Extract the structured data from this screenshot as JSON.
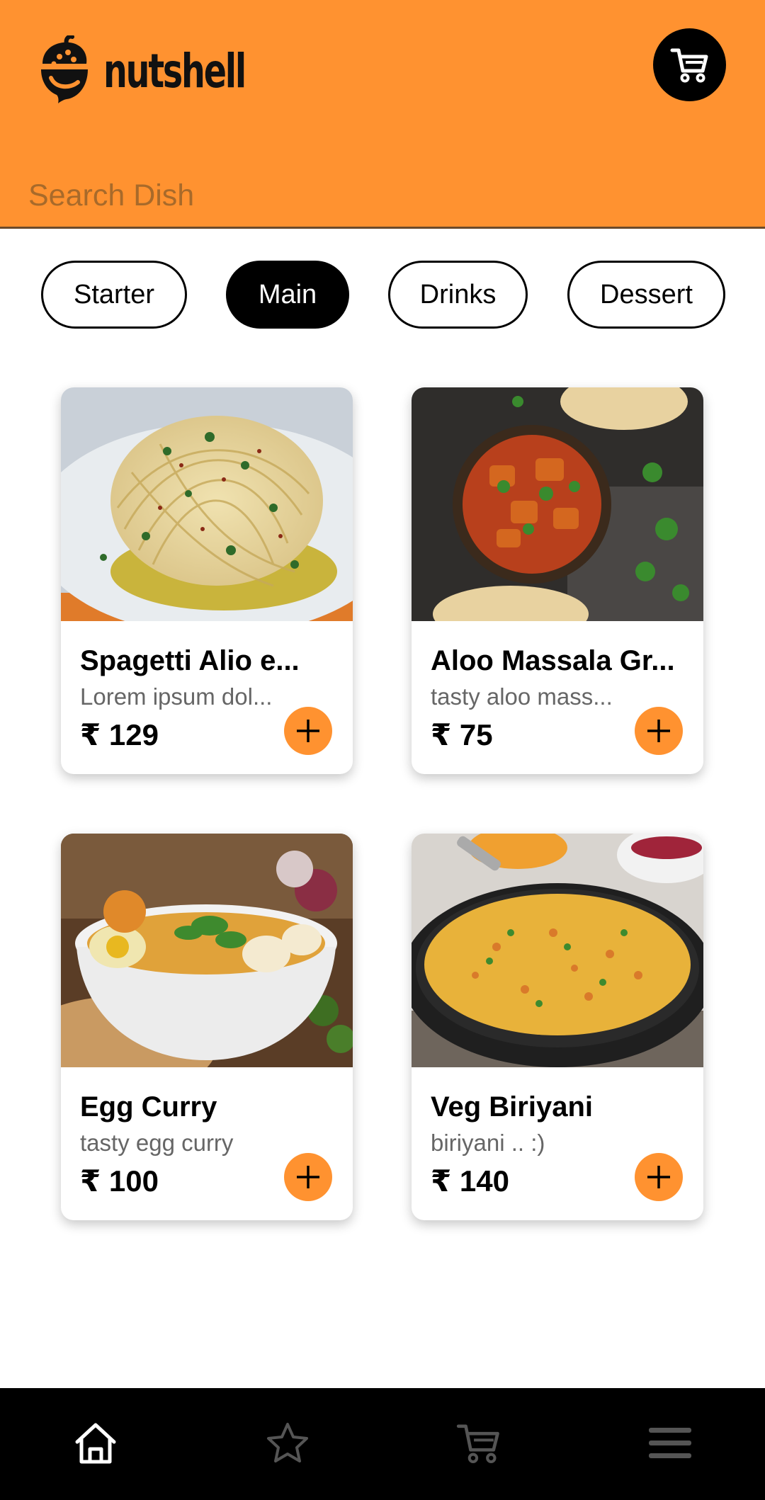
{
  "app": {
    "name": "nutshell"
  },
  "header": {
    "cart_icon": "cart-icon",
    "logo_icon": "acorn-logo-icon"
  },
  "search": {
    "placeholder": "Search Dish",
    "value": ""
  },
  "categories": [
    {
      "label": "Starter",
      "active": false
    },
    {
      "label": "Main",
      "active": true
    },
    {
      "label": "Drinks",
      "active": false
    },
    {
      "label": "Dessert",
      "active": false
    }
  ],
  "dishes": [
    {
      "name": "Spagetti Alio e...",
      "description": "Lorem ipsum dol...",
      "price": "₹ 129",
      "image": "spaghetti-image"
    },
    {
      "name": "Aloo Massala Gr...",
      "description": "tasty aloo mass...",
      "price": "₹ 75",
      "image": "aloo-masala-image"
    },
    {
      "name": "Egg Curry",
      "description": "tasty egg curry",
      "price": "₹ 100",
      "image": "egg-curry-image"
    },
    {
      "name": "Veg Biriyani",
      "description": "biriyani .. :)",
      "price": "₹ 140",
      "image": "veg-biriyani-image"
    }
  ],
  "bottom_nav": [
    {
      "icon": "home-icon",
      "active": true
    },
    {
      "icon": "star-icon",
      "active": false
    },
    {
      "icon": "cart-icon",
      "active": false
    },
    {
      "icon": "menu-icon",
      "active": false
    }
  ],
  "colors": {
    "accent": "#FF9230",
    "dark": "#000000",
    "active_nav": "#ffffff",
    "inactive_nav": "#555555"
  }
}
